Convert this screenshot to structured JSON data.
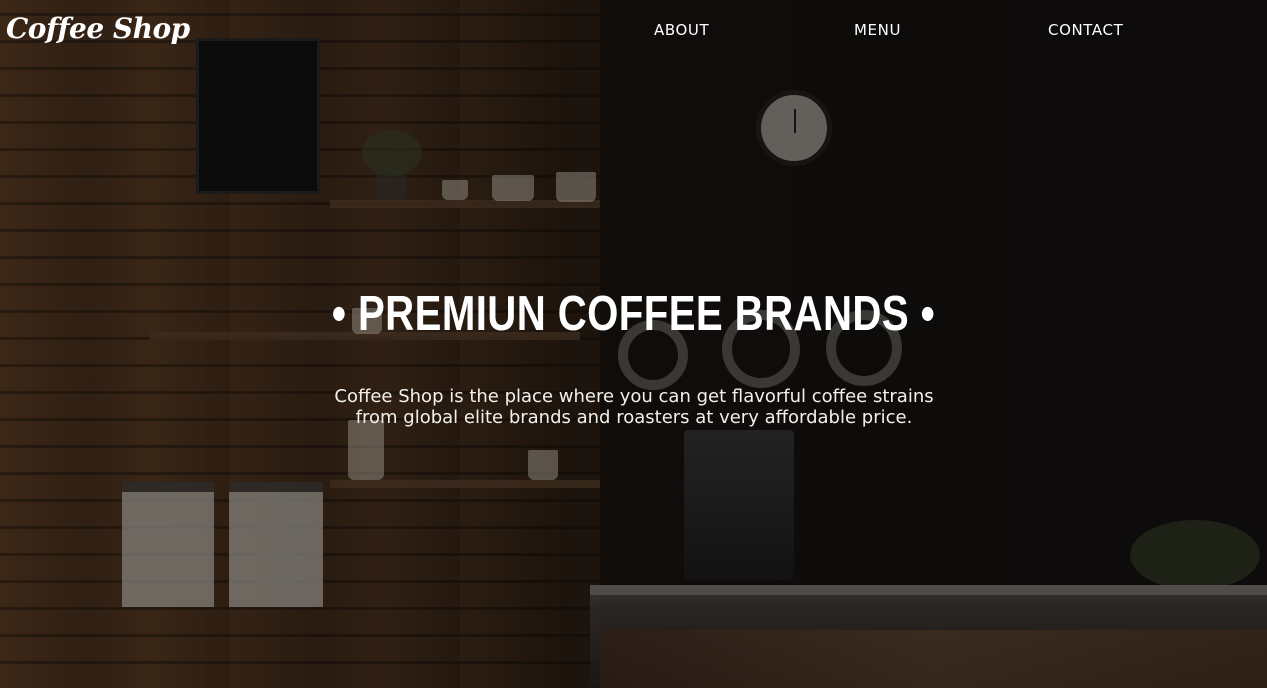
{
  "header": {
    "brand": "Coffee Shop",
    "nav": [
      {
        "label": "ABOUT"
      },
      {
        "label": "MENU"
      },
      {
        "label": "CONTACT"
      }
    ]
  },
  "hero": {
    "title": "• PREMIUN COFFEE BRANDS •",
    "description": "Coffee Shop is the place where you can get flavorful coffee strains from global elite brands and roasters at very affordable price."
  },
  "colors": {
    "text": "#ffffff",
    "background": "#1a120c"
  }
}
